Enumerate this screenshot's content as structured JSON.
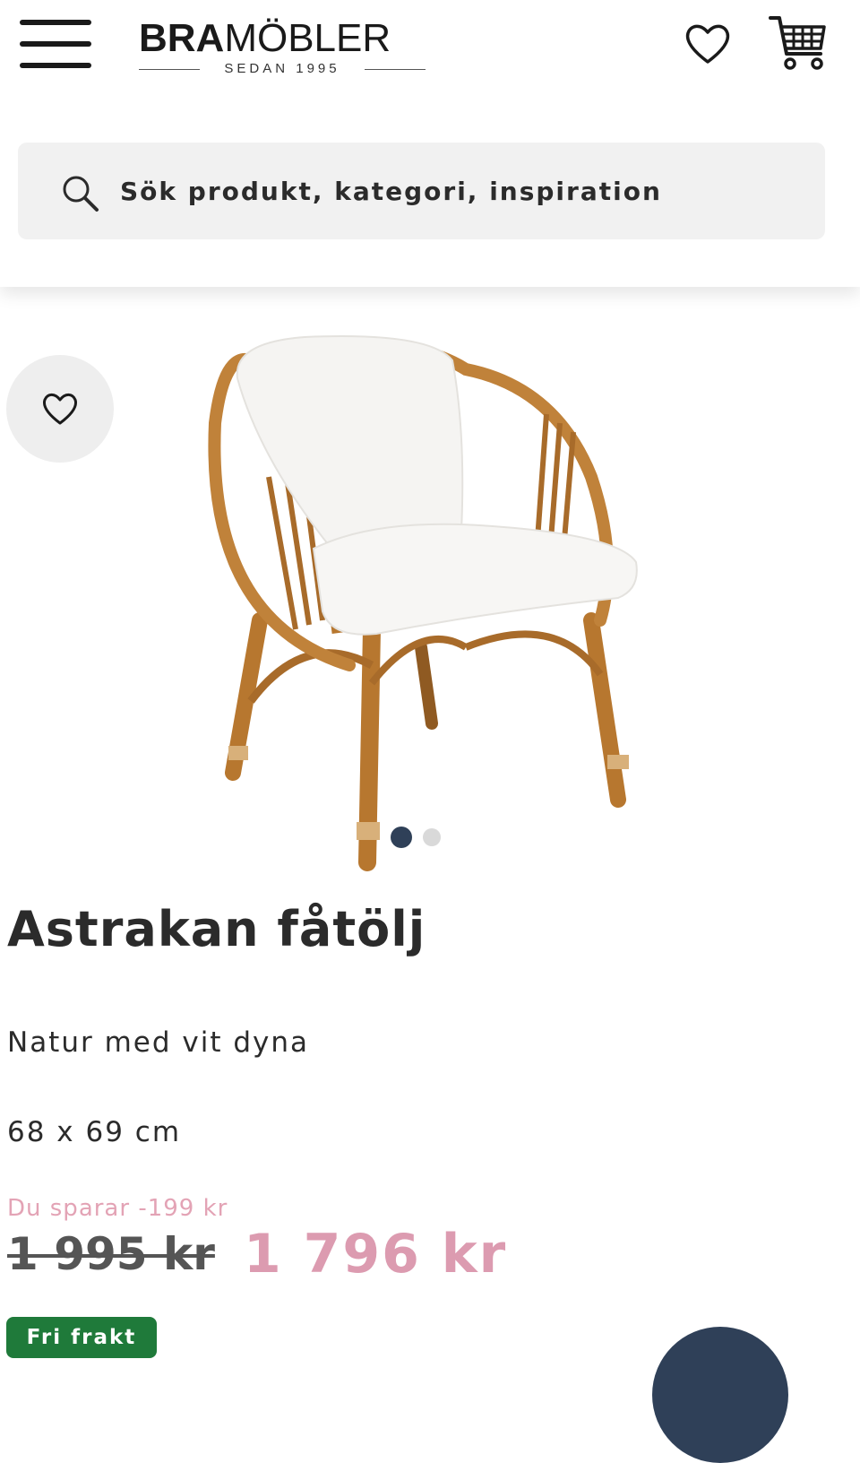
{
  "header": {
    "logo": {
      "brand_bold": "BRA",
      "brand_light": "MÖBLER",
      "tagline": "SEDAN 1995"
    }
  },
  "search": {
    "placeholder": "Sök produkt, kategori, inspiration"
  },
  "gallery": {
    "total_images": 2,
    "active_index": 0
  },
  "product": {
    "title": "Astrakan fåtölj",
    "variant": "Natur med vit dyna",
    "dimensions": "68 x 69 cm",
    "saving_text": "Du sparar -199 kr",
    "old_price": "1 995 kr",
    "price": "1 796 kr",
    "badge": "Fri frakt"
  },
  "icons": {
    "menu": "hamburger-menu-icon",
    "wishlist": "heart-icon",
    "cart": "shopping-cart-icon",
    "search": "search-icon"
  },
  "colors": {
    "accent_navy": "#2f4058",
    "price_pink": "#dc9bb0",
    "badge_green": "#1f7a3a",
    "search_bg": "#f1f1f1"
  }
}
